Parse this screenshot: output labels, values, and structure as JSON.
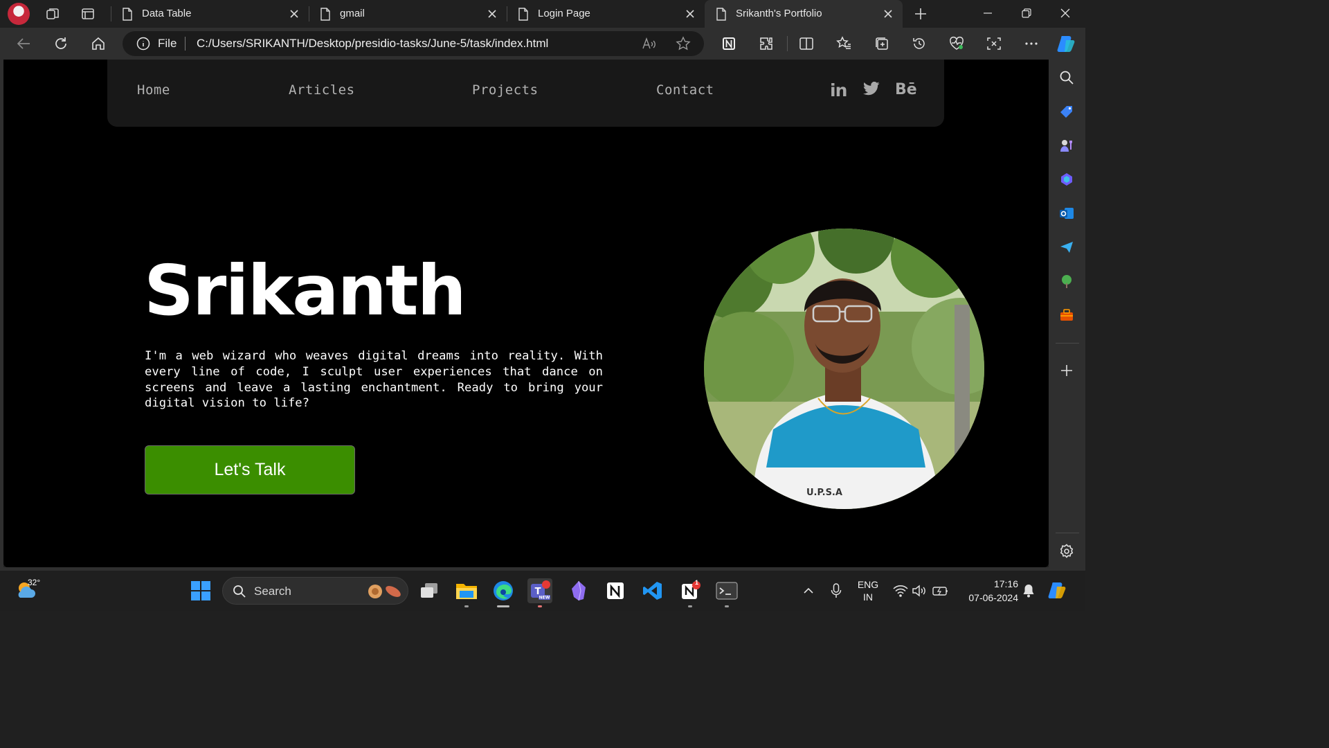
{
  "browser": {
    "tabs": [
      {
        "title": "Data Table",
        "active": false
      },
      {
        "title": "gmail",
        "active": false
      },
      {
        "title": "Login Page",
        "active": false
      },
      {
        "title": "Srikanth's Portfolio",
        "active": true
      }
    ],
    "address": {
      "scheme_label": "File",
      "url": "C:/Users/SRIKANTH/Desktop/presidio-tasks/June-5/task/index.html"
    }
  },
  "site": {
    "nav": {
      "links": [
        "Home",
        "Articles",
        "Projects",
        "Contact"
      ],
      "social": [
        "in",
        "twitter",
        "Bē"
      ]
    },
    "hero": {
      "name": "Srikanth",
      "bio": "I'm a web wizard who weaves digital dreams into reality. With every line of code, I sculpt user experiences that dance on screens and leave a lasting enchantment. Ready to bring your digital vision to life?",
      "cta": "Let's Talk"
    },
    "colors": {
      "accent": "#3b8e00",
      "nav_bg": "#181818",
      "page_bg": "#000000"
    }
  },
  "taskbar": {
    "weather": "32°",
    "search_label": "Search",
    "notion_badge": "1",
    "language": {
      "line1": "ENG",
      "line2": "IN"
    },
    "clock": {
      "time": "17:16",
      "date": "07-06-2024"
    }
  }
}
